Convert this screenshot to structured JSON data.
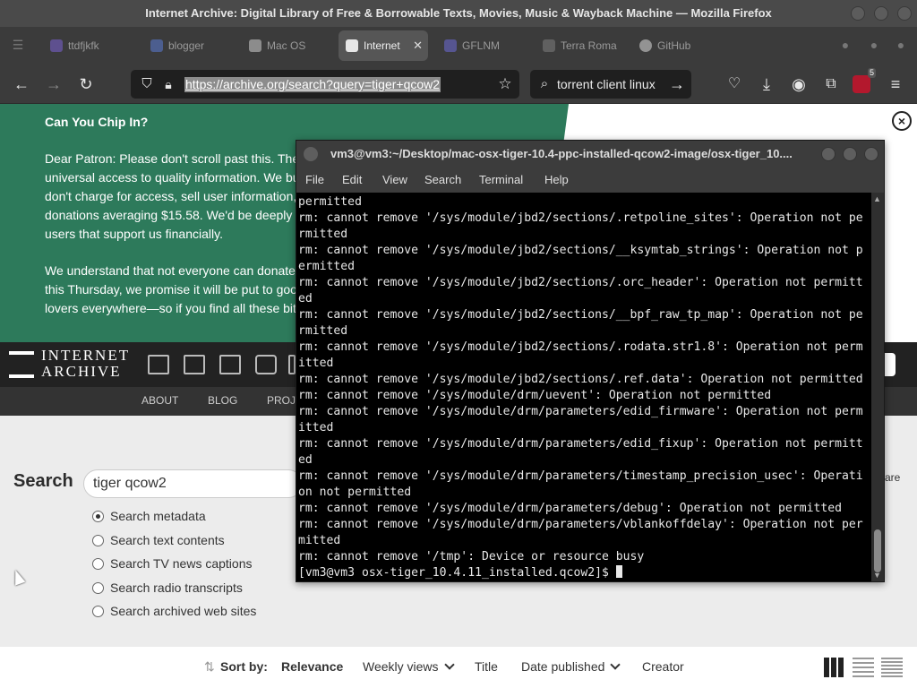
{
  "window": {
    "title": "Internet Archive: Digital Library of Free & Borrowable Texts, Movies, Music & Wayback Machine — Mozilla Firefox"
  },
  "tabs": [
    {
      "label": "ttdfjkfk",
      "favicon_color": "#7b63d6"
    },
    {
      "label": "blogger",
      "favicon_color": "#5b7bd6"
    },
    {
      "label": "Mac OS",
      "favicon_color": "#cfcfcf"
    },
    {
      "label": "Internet",
      "favicon_color": "#e6e6e6",
      "active": true
    },
    {
      "label": "GFLNM",
      "favicon_color": "#6d6bd8"
    },
    {
      "label": "Terra Roma",
      "favicon_color": "#7f7f7f"
    },
    {
      "label": "GitHub",
      "favicon_color": "#dcdcdc"
    }
  ],
  "navbar": {
    "url": "https://archive.org/search?query=tiger+qcow2",
    "search_query": "torrent client linux",
    "extension_badge": "5"
  },
  "donation_banner": {
    "title": "Can You Chip In?",
    "paragraph1": "Dear Patron: Please don't scroll past this. The universal access to quality information. We bu don't charge for access, sell user information, donations averaging $15.58. We'd be deeply users that support us financially.",
    "paragraph2": "We understand that not everyone can donate this Thursday, we promise it will be put to goo lovers everywhere—so if you find all these bit",
    "close_label": "×"
  },
  "ia_header": {
    "logo_line1": "INTERNET",
    "logo_line2": "ARCHIVE",
    "subnav": [
      "ABOUT",
      "BLOG",
      "PROJ"
    ]
  },
  "search": {
    "label": "Search",
    "query": "tiger qcow2",
    "options": [
      {
        "label": "Search metadata",
        "checked": true
      },
      {
        "label": "Search text contents",
        "checked": false
      },
      {
        "label": "Search TV news captions",
        "checked": false
      },
      {
        "label": "Search radio transcripts",
        "checked": false
      },
      {
        "label": "Search archived web sites",
        "checked": false
      }
    ],
    "side_fragment": "are"
  },
  "sort": {
    "label": "Sort by:",
    "items": [
      "Relevance",
      "Weekly views",
      "Title",
      "Date published",
      "Creator"
    ]
  },
  "terminal": {
    "title": "vm3@vm3:~/Desktop/mac-osx-tiger-10.4-ppc-installed-qcow2-image/osx-tiger_10....",
    "menu": [
      "File",
      "Edit",
      "View",
      "Search",
      "Terminal",
      "Help"
    ],
    "output": [
      "permitted",
      "rm: cannot remove '/sys/module/jbd2/sections/.retpoline_sites': Operation not pe",
      "rmitted",
      "rm: cannot remove '/sys/module/jbd2/sections/__ksymtab_strings': Operation not p",
      "ermitted",
      "rm: cannot remove '/sys/module/jbd2/sections/.orc_header': Operation not permitt",
      "ed",
      "rm: cannot remove '/sys/module/jbd2/sections/__bpf_raw_tp_map': Operation not pe",
      "rmitted",
      "rm: cannot remove '/sys/module/jbd2/sections/.rodata.str1.8': Operation not perm",
      "itted",
      "rm: cannot remove '/sys/module/jbd2/sections/.ref.data': Operation not permitted",
      "rm: cannot remove '/sys/module/drm/uevent': Operation not permitted",
      "rm: cannot remove '/sys/module/drm/parameters/edid_firmware': Operation not perm",
      "itted",
      "rm: cannot remove '/sys/module/drm/parameters/edid_fixup': Operation not permitt",
      "ed",
      "rm: cannot remove '/sys/module/drm/parameters/timestamp_precision_usec': Operati",
      "on not permitted",
      "rm: cannot remove '/sys/module/drm/parameters/debug': Operation not permitted",
      "rm: cannot remove '/sys/module/drm/parameters/vblankoffdelay': Operation not per",
      "mitted",
      "rm: cannot remove '/tmp': Device or resource busy"
    ],
    "prompt": "[vm3@vm3 osx-tiger_10.4.11_installed.qcow2]$ "
  }
}
